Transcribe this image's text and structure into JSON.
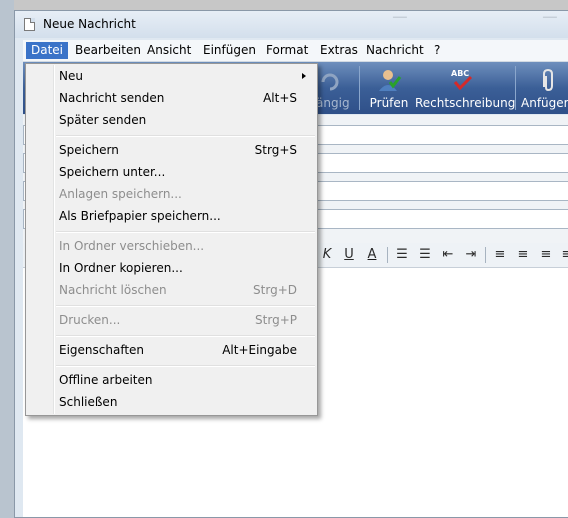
{
  "window": {
    "title": "Neue Nachricht"
  },
  "menubar": {
    "items": [
      "Datei",
      "Bearbeiten",
      "Ansicht",
      "Einfügen",
      "Format",
      "Extras",
      "Nachricht",
      "?"
    ]
  },
  "toolbar": {
    "undo_partial": "gängig",
    "check": "Prüfen",
    "spelling": "Rechtschreibung",
    "attach": "Anfüger"
  },
  "format": {
    "italic": "K",
    "underline": "U",
    "font_color": "A"
  },
  "file_menu": {
    "new": "Neu",
    "send": "Nachricht senden",
    "send_sc": "Alt+S",
    "send_later": "Später senden",
    "save": "Speichern",
    "save_sc": "Strg+S",
    "save_as": "Speichern unter...",
    "save_attachments": "Anlagen speichern...",
    "save_stationery": "Als Briefpapier speichern...",
    "move_to_folder": "In Ordner verschieben...",
    "copy_to_folder": "In Ordner kopieren...",
    "delete": "Nachricht löschen",
    "delete_sc": "Strg+D",
    "print": "Drucken...",
    "print_sc": "Strg+P",
    "properties": "Eigenschaften",
    "properties_sc": "Alt+Eingabe",
    "work_offline": "Offline arbeiten",
    "close": "Schließen"
  }
}
